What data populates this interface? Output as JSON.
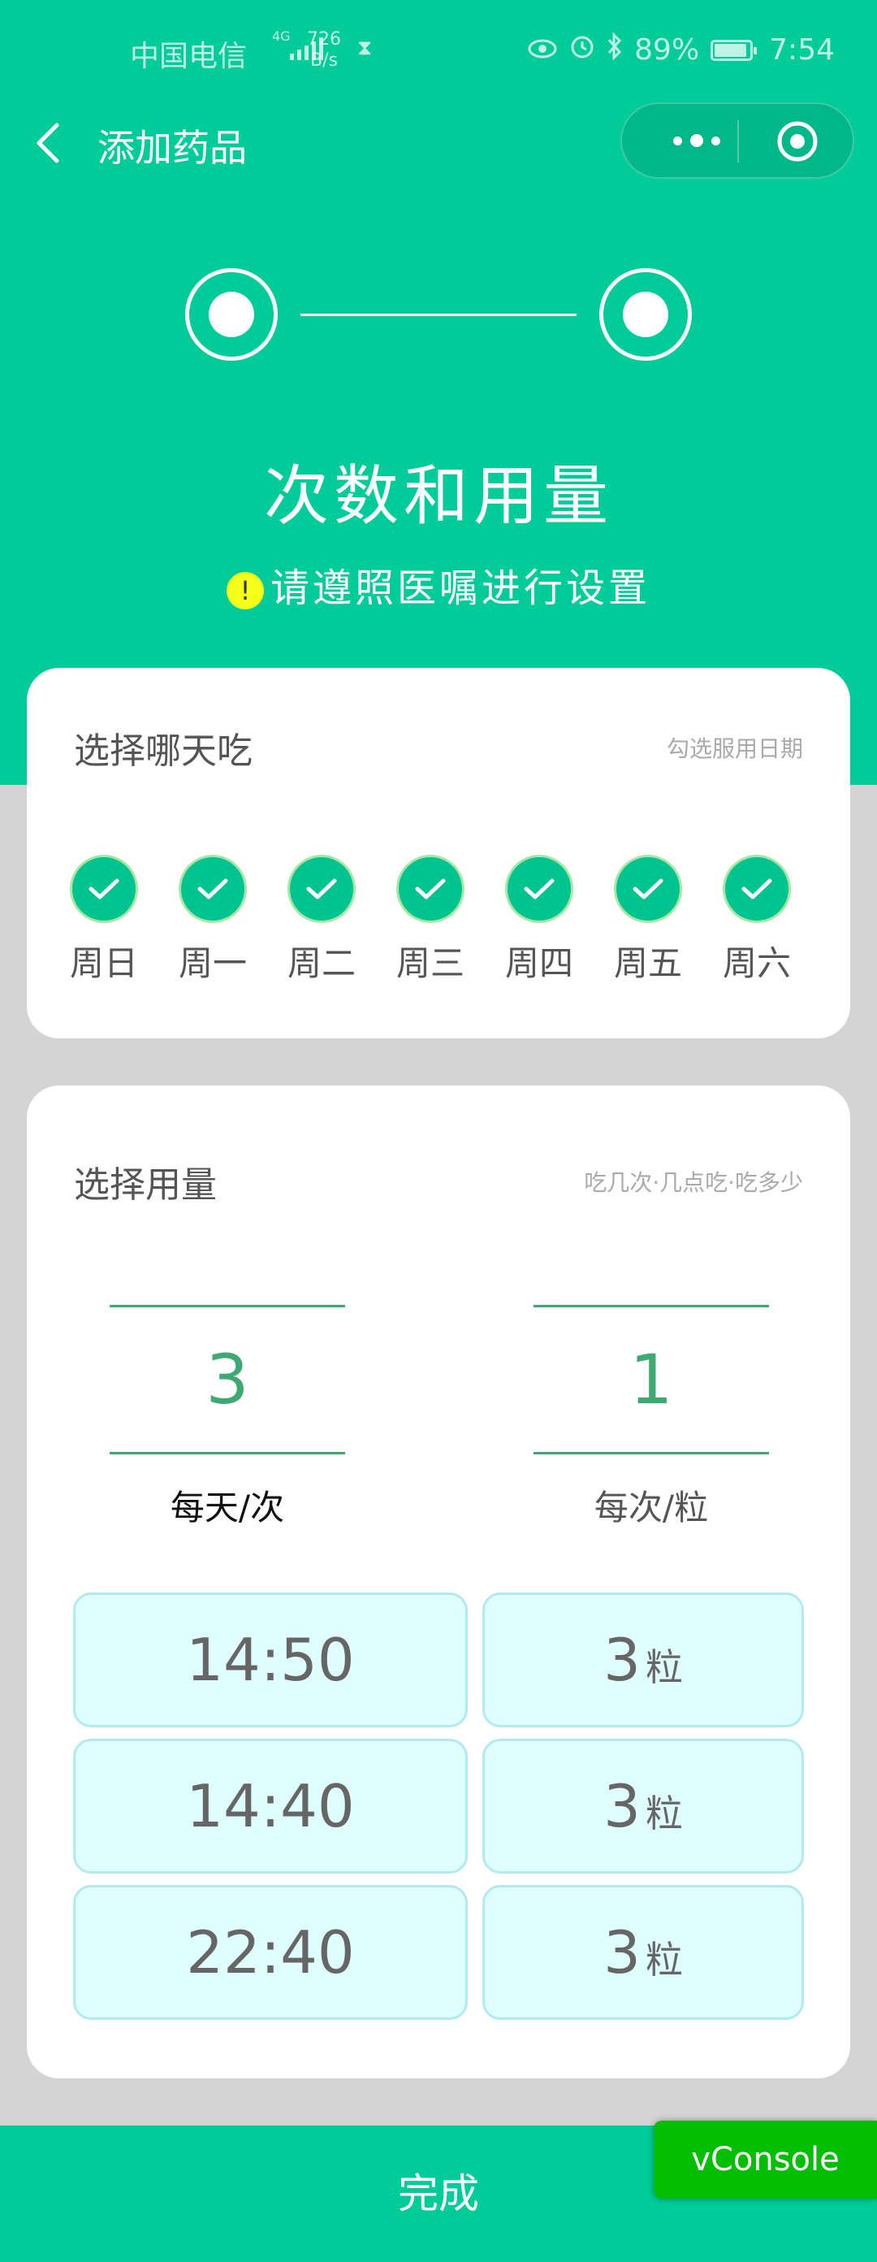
{
  "status_bar": {
    "carrier": "中国电信",
    "network": "4G",
    "speed_value": "726",
    "speed_unit": "B/s",
    "battery": "89%",
    "time": "7:54"
  },
  "nav": {
    "title": "添加药品"
  },
  "steps": {
    "title": "次数和用量",
    "hint": "请遵照医嘱进行设置",
    "warn_symbol": "!"
  },
  "days_card": {
    "title": "选择哪天吃",
    "hint": "勾选服用日期",
    "days": [
      {
        "label": "周日",
        "checked": true
      },
      {
        "label": "周一",
        "checked": true
      },
      {
        "label": "周二",
        "checked": true
      },
      {
        "label": "周三",
        "checked": true
      },
      {
        "label": "周四",
        "checked": true
      },
      {
        "label": "周五",
        "checked": true
      },
      {
        "label": "周六",
        "checked": true
      }
    ]
  },
  "dosage_card": {
    "title": "选择用量",
    "hint": "吃几次·几点吃·吃多少",
    "times_per_day": {
      "value": "3",
      "label": "每天/次"
    },
    "pills_per_time": {
      "value": "1",
      "label": "每次/粒"
    },
    "schedule": [
      {
        "time": "14:50",
        "qty": "3",
        "unit": "粒"
      },
      {
        "time": "14:40",
        "qty": "3",
        "unit": "粒"
      },
      {
        "time": "22:40",
        "qty": "3",
        "unit": "粒"
      }
    ]
  },
  "footer": {
    "done_label": "完成"
  },
  "vconsole": {
    "label": "vConsole"
  },
  "colors": {
    "primary": "#00cc99",
    "check": "#00c48f",
    "value_green": "#3daa72",
    "cell_bg": "#dfffff",
    "vconsole": "#04be02"
  }
}
